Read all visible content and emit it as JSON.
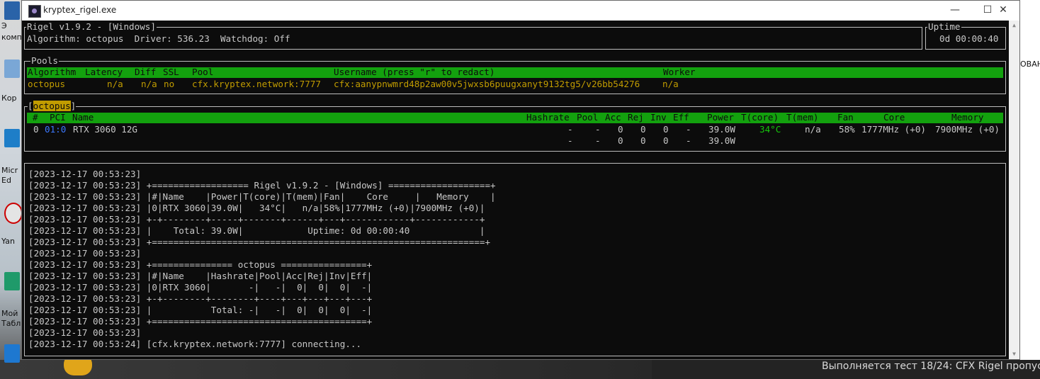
{
  "window": {
    "title": "kryptex_rigel.exe",
    "minimize": "—",
    "maximize": "☐",
    "close": "✕"
  },
  "header": {
    "title": "Rigel v1.9.2 - [Windows]",
    "line": "Algorithm: octopus  Driver: 536.23  Watchdog: Off",
    "uptime_title": "Uptime",
    "uptime_value": "0d 00:00:40"
  },
  "pools": {
    "title": "Pools",
    "headers": {
      "algorithm": "Algorithm",
      "latency": "Latency",
      "diff": "Diff",
      "ssl": "SSL",
      "pool": "Pool",
      "username": "Username (press \"r\" to redact)",
      "worker": "Worker"
    },
    "row": {
      "algorithm": "octopus",
      "latency": "n/a",
      "diff": "n/a",
      "ssl": "no",
      "pool": "cfx.kryptex.network:7777",
      "username": "cfx:aanypnwmrd48p2aw00v5jwxsb6puugxanyt9132tg5/v26bb54276",
      "worker": "n/a"
    }
  },
  "devices": {
    "algo_open": "[",
    "algo": "octopus",
    "algo_close": "]",
    "headers": {
      "num": "#",
      "pci": "PCI",
      "name": "Name",
      "hashrate": "Hashrate",
      "pool": "Pool",
      "acc": "Acc",
      "rej": "Rej",
      "inv": "Inv",
      "eff": "Eff",
      "power": "Power",
      "tcore": "T(core)",
      "tmem": "T(mem)",
      "fan": "Fan",
      "core": "Core",
      "memory": "Memory"
    },
    "row": {
      "num": "0",
      "pci": "01:0",
      "name": "RTX 3060 12G",
      "hashrate": "-",
      "pool": "-",
      "acc": "0",
      "rej": "0",
      "inv": "0",
      "eff": "-",
      "power": "39.0W",
      "tcore": "34°C",
      "tmem": "n/a",
      "fan": "58%",
      "core": "1777MHz (+0)",
      "memory": "7900MHz (+0)"
    },
    "total": {
      "hashrate": "-",
      "pool": "-",
      "acc": "0",
      "rej": "0",
      "inv": "0",
      "eff": "-",
      "power": "39.0W"
    }
  },
  "log": [
    "[2023-12-17 00:53:23]",
    "[2023-12-17 00:53:23] +================== Rigel v1.9.2 - [Windows] ===================+",
    "[2023-12-17 00:53:23] |#|Name    |Power|T(core)|T(mem)|Fan|    Core     |   Memory    |",
    "[2023-12-17 00:53:23] |0|RTX 3060|39.0W|   34°C|   n/a|58%|1777MHz (+0)|7900MHz (+0)|",
    "[2023-12-17 00:53:23] +-+--------+-----+-------+------+---+------------+------------+",
    "[2023-12-17 00:53:23] |    Total: 39.0W|            Uptime: 0d 00:00:40             |",
    "[2023-12-17 00:53:23] +==============================================================+",
    "[2023-12-17 00:53:23]",
    "[2023-12-17 00:53:23] +=============== octopus ================+",
    "[2023-12-17 00:53:23] |#|Name    |Hashrate|Pool|Acc|Rej|Inv|Eff|",
    "[2023-12-17 00:53:23] |0|RTX 3060|       -|   -|  0|  0|  0|  -|",
    "[2023-12-17 00:53:23] +-+--------+--------+----+---+---+---+---+",
    "[2023-12-17 00:53:23] |           Total: -|   -|  0|  0|  0|  -|",
    "[2023-12-17 00:53:23] +========================================+",
    "[2023-12-17 00:53:23]",
    "[2023-12-17 00:53:24] [cfx.kryptex.network:7777] connecting..."
  ],
  "desktop": {
    "labels": [
      "Э",
      "комп",
      "Кор",
      "Micr",
      "Ed",
      "Yan",
      "Мой",
      "Табл"
    ],
    "right_fragment": "ОВАН",
    "status_text": "Выполняется тест 18/24: CFX Rigel пропус"
  }
}
